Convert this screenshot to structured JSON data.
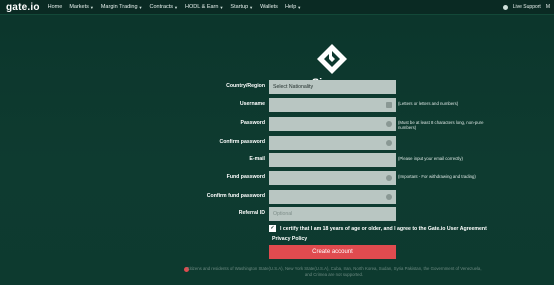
{
  "header": {
    "logo": "gate.io",
    "nav": [
      "Home",
      "Markets",
      "Margin Trading",
      "Contracts",
      "HODL & Earn",
      "Startup",
      "Wallets",
      "Help"
    ],
    "nav_has_caret": [
      false,
      true,
      true,
      true,
      true,
      true,
      false,
      true
    ],
    "live_support": "Live Support",
    "user_initial": "M"
  },
  "title": "Sign up",
  "form": {
    "country_label": "Country/Region",
    "country_value": "Select Nationality",
    "username_label": "Username",
    "username_hint": "(Letters or letters and numbers)",
    "password_label": "Password",
    "password_hint": "(Must be at least 8 characters long, non-pure numbers)",
    "confirm_password_label": "Confirm password",
    "email_label": "E-mail",
    "email_hint": "(Please input your email correctly)",
    "fund_password_label": "Fund password",
    "fund_password_hint": "(Important - For withdrawing and trading)",
    "confirm_fund_password_label": "Confirm fund password",
    "referral_label": "Referral ID",
    "referral_placeholder": "Optional"
  },
  "agreement": "I certify that I am 18 years of age or older, and I agree to the  Gate.io User Agreement",
  "privacy": "Privacy Policy",
  "create_button": "Create account",
  "notice": "Citizens and residents of Washington State(U.S.A), New York State(U.S.A), Cuba, Iran, North Korea, Sudan, Syria Pakistan, the Government of Venezuela, and Crimea are not supported."
}
